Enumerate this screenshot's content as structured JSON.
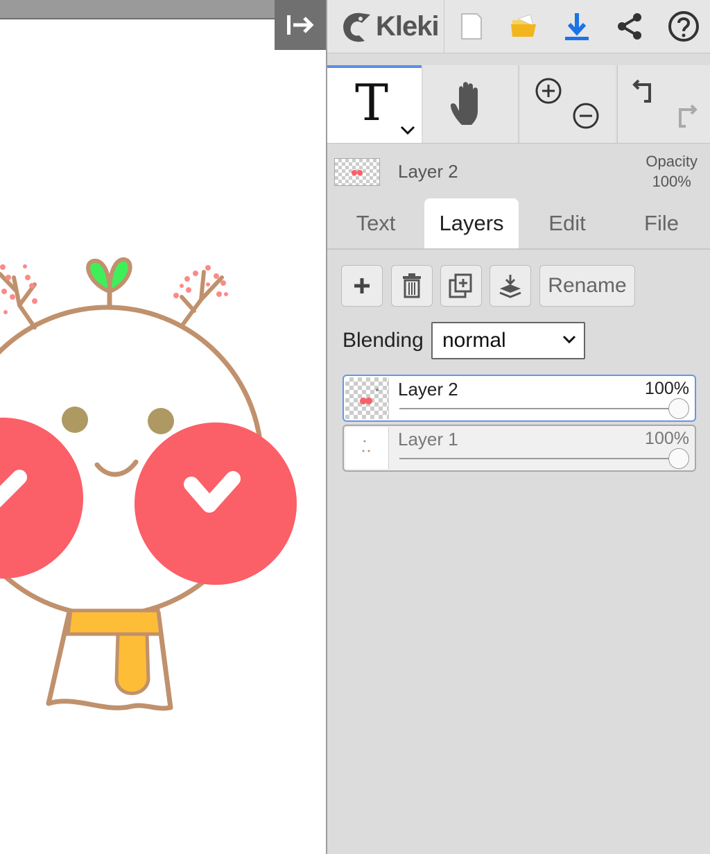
{
  "app": {
    "name": "Kleki"
  },
  "toolbar": {
    "icons": [
      "new-image-icon",
      "open-folder-icon",
      "download-icon",
      "share-icon",
      "help-icon"
    ]
  },
  "tools": {
    "active": "text-tool",
    "items": [
      "text-tool",
      "hand-tool",
      "zoom-in",
      "zoom-out",
      "undo",
      "redo"
    ]
  },
  "current_layer": {
    "name": "Layer 2",
    "opacity_label": "Opacity",
    "opacity_value": "100%"
  },
  "tabs": [
    {
      "label": "Text",
      "active": false
    },
    {
      "label": "Layers",
      "active": true
    },
    {
      "label": "Edit",
      "active": false
    },
    {
      "label": "File",
      "active": false
    }
  ],
  "layer_actions": {
    "rename_label": "Rename",
    "icons": [
      "add-layer-icon",
      "delete-layer-icon",
      "duplicate-layer-icon",
      "merge-down-icon"
    ]
  },
  "blending": {
    "label": "Blending",
    "value": "normal"
  },
  "layers": [
    {
      "name": "Layer 2",
      "opacity": "100%",
      "opacity_fraction": 1.0,
      "selected": true
    },
    {
      "name": "Layer 1",
      "opacity": "100%",
      "opacity_fraction": 1.0,
      "selected": false
    }
  ],
  "colors": {
    "accent": "#5d8ee6",
    "download": "#1a73e8",
    "folder": "#f2b61c",
    "cheek": "#fb5f68",
    "outline": "#c0916c",
    "sprout": "#3df05a",
    "scarf": "#fdbd36"
  }
}
